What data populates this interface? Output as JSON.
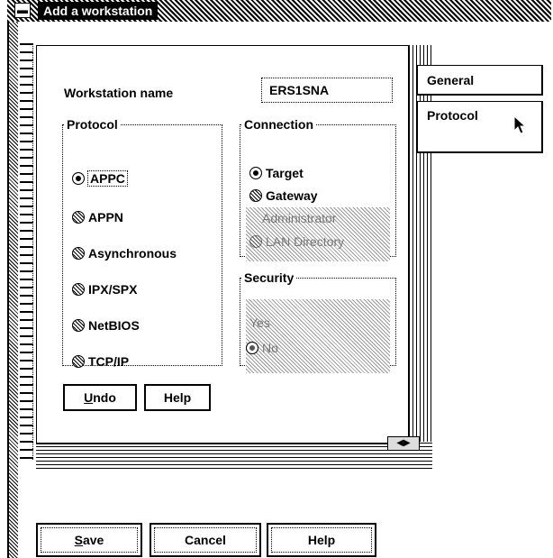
{
  "window": {
    "title": "Add a workstation",
    "sysmenu_icon": "system-menu-icon"
  },
  "tabs": [
    {
      "label": "General"
    },
    {
      "label": "Protocol"
    }
  ],
  "workstation": {
    "label": "Workstation name",
    "value": "ERS1SNA"
  },
  "protocol": {
    "legend": "Protocol",
    "options": [
      "APPC",
      "APPN",
      "Asynchronous",
      "IPX/SPX",
      "NetBIOS",
      "TCP/IP"
    ],
    "selected": "APPC"
  },
  "connection": {
    "legend": "Connection",
    "options": [
      "Target",
      "Gateway",
      "Administrator",
      "LAN Directory"
    ],
    "selected": "Target",
    "disabled": [
      "Administrator",
      "LAN Directory"
    ]
  },
  "security": {
    "legend": "Security",
    "options": [
      "Yes",
      "No"
    ],
    "selected": "No",
    "disabled": [
      "Yes",
      "No"
    ]
  },
  "page_buttons": {
    "undo_mnemonic": "U",
    "undo_rest": "ndo",
    "help": "Help"
  },
  "dialog_buttons": {
    "save_mnemonic": "S",
    "save_rest": "ave",
    "cancel": "Cancel",
    "help": "Help"
  }
}
